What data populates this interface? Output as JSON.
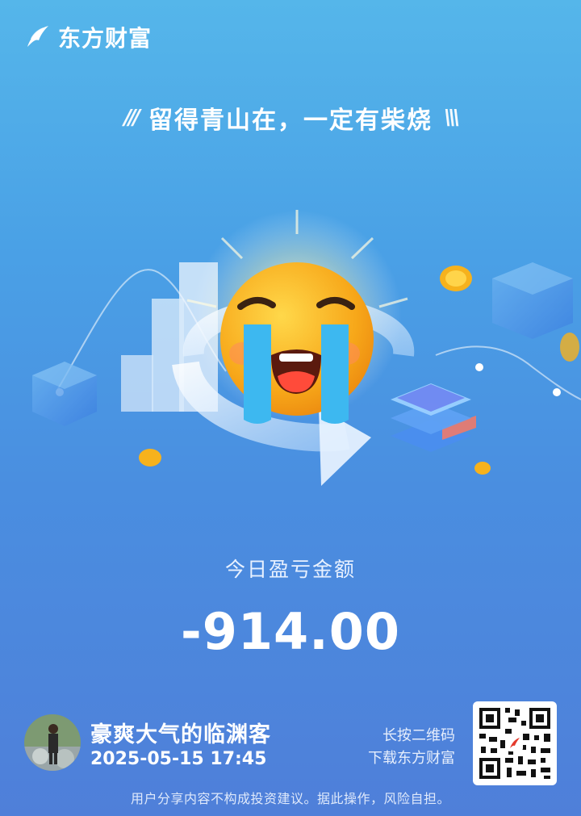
{
  "brand": {
    "name": "东方财富"
  },
  "slogan": {
    "text": "留得青山在，一定有柴烧"
  },
  "profit_loss": {
    "label": "今日盈亏金额",
    "amount": "-914.00"
  },
  "user": {
    "name": "豪爽大气的临渊客",
    "datetime": "2025-05-15 17:45"
  },
  "qr": {
    "hint_line1": "长按二维码",
    "hint_line2": "下载东方财富"
  },
  "footer": {
    "disclaimer": "用户分享内容不构成投资建议。据此操作，风险自担。"
  },
  "colors": {
    "bg_top": "#55b6ea",
    "bg_bottom": "#4f7fd9",
    "emoji": "#f7a719",
    "tears": "#3db8f0"
  },
  "icons": {
    "logo": "eastmoney-logo-icon",
    "emoji": "crying-face-icon"
  }
}
